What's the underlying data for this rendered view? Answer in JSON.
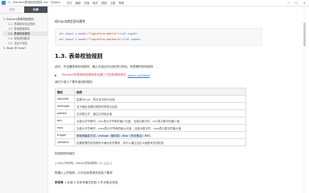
{
  "window": {
    "title": "3、Element表单校验规则.md - Typora",
    "menus": [
      "文件",
      "编辑",
      "段落",
      "格式",
      "视图",
      "主题",
      "帮助"
    ],
    "controls": [
      "—",
      "☐",
      "✕"
    ]
  },
  "sidebar": {
    "tabs": [
      "文件",
      "大纲"
    ],
    "active_tab_index": 1,
    "items": [
      {
        "label": "1. Element表单校验规则",
        "level": 1
      },
      {
        "label": "1.1. 表单基本验证规则",
        "level": 2
      },
      {
        "label": "1.2. 表单数据绑定",
        "level": 2
      },
      {
        "label": "1.3. 表单校验规则",
        "level": 2
      },
      {
        "label": "1.4. 校验规则触发",
        "level": 2
      },
      {
        "label": "1.5. 自定义校验",
        "level": 2
      },
      {
        "label": "2. Store 中 Vuex?",
        "level": 1
      }
    ],
    "selected_index": 3
  },
  "content": {
    "intro": "给input绑定双向属性",
    "code_lines": [
      {
        "open": "<el-input ",
        "attr": "v-model=",
        "val": "\"loginForm.mobile\"",
        "close": "></el-input>"
      },
      {
        "open": "<el-input ",
        "attr": "v-model=",
        "val": "\"loginForm.password\"",
        "close": "></el-input>"
      }
    ],
    "heading": "1.3. 表单校验规则",
    "paragraph": "此时，先设置表单校验规则，输入内容后可对其进行校验，有逻辑的校验规则",
    "bullet_text": "Element的表单校验规则来自第三方校验规则参见",
    "bullet_link": "async-validator",
    "note": "我们介绍几个基本使用的规则",
    "table": {
      "headers": [
        "规则",
        "说明"
      ],
      "rows": [
        {
          "rule": "required",
          "desc": "如果为true，表示该字段为必填"
        },
        {
          "rule": "message",
          "desc": "当不满足设置的规则时的提示信息"
        },
        {
          "rule": "pattern",
          "desc": "正则表达式，通过正则验证值"
        },
        {
          "rule": "min",
          "desc": "当值为字符串时，min表示字符串的最小长度，当值为数字时，min表示数字的最小值"
        },
        {
          "rule": "max",
          "desc": "当值为字符串时，max表示字符串的最大长度，当值为数字时，max表示数字的最大值"
        },
        {
          "rule": "trigger",
          "desc_hl": "校验的触发方式，change（值改变）/blur（失去焦点）",
          "desc_rest": "两种。"
        },
        {
          "rule": "validator",
          "desc": "如果配置的校验规则不满足你的需求，你可以通过自定义函数来完成校验"
        }
      ]
    },
    "after_table": "校验规则的格式",
    "format_line": "{ key(字段名): value(校验规则) => [{}] }",
    "para_rules": "根据以上的规则，针对当前表单完成如下要求",
    "para_mobile_label": "手机号",
    "para_mobile": "1.必填 2.手机号格式校验 3.失去焦点校验"
  },
  "colors": {
    "accent": "#3a8ee6",
    "sidebar_bg": "#f7f7f8",
    "active_tab_bg": "#4b4f57",
    "link": "#2f7ad6",
    "highlight": "#dfe9f7"
  }
}
